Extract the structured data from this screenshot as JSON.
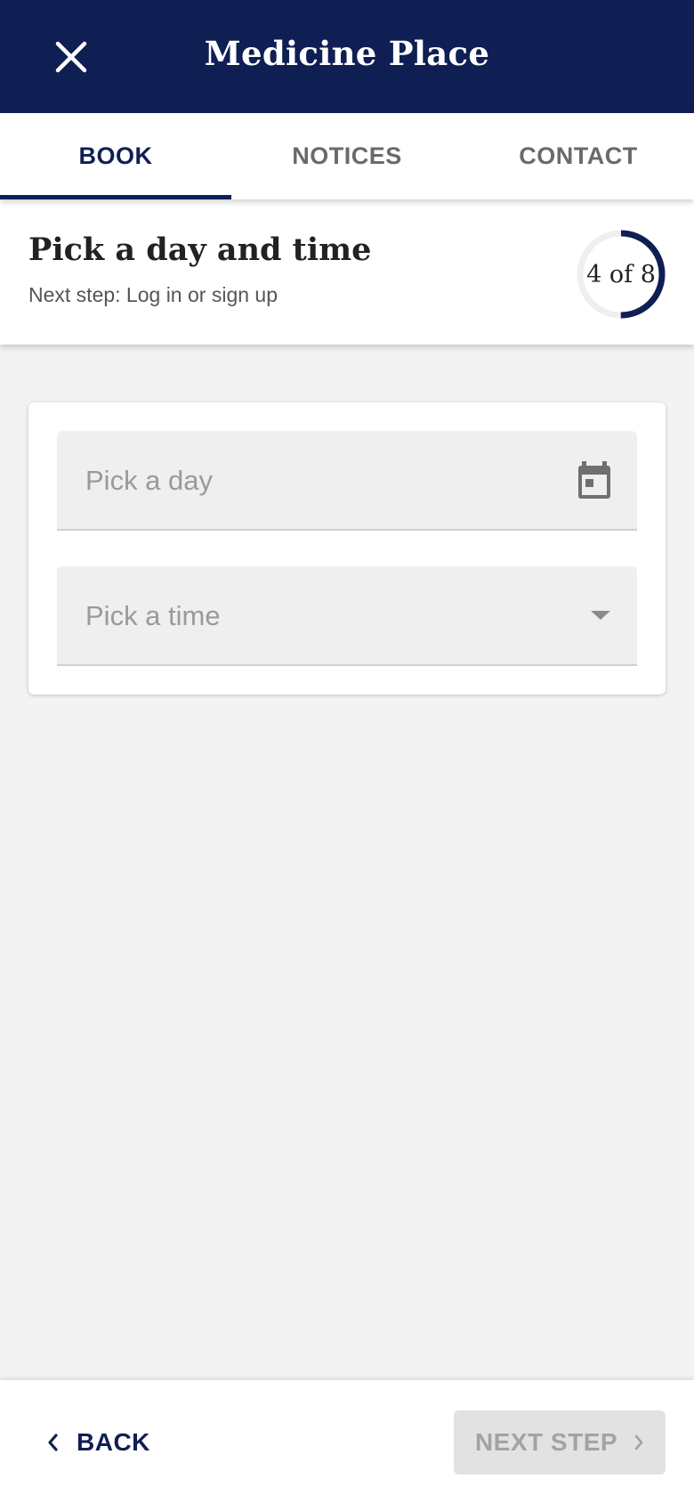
{
  "header": {
    "title": "Medicine Place",
    "close_icon": "close-icon"
  },
  "tabs": [
    {
      "label": "BOOK",
      "active": true
    },
    {
      "label": "NOTICES",
      "active": false
    },
    {
      "label": "CONTACT",
      "active": false
    }
  ],
  "step": {
    "title": "Pick a day and time",
    "next_step": "Next step: Log in or sign up",
    "progress_label": "4 of 8",
    "current": 4,
    "total": 8
  },
  "form": {
    "day": {
      "placeholder": "Pick a day",
      "value": "",
      "icon": "calendar-icon"
    },
    "time": {
      "placeholder": "Pick a time",
      "value": "",
      "icon": "dropdown-arrow-icon"
    }
  },
  "footer": {
    "back_label": "BACK",
    "next_label": "NEXT STEP",
    "next_enabled": false
  },
  "colors": {
    "primary": "#0f1f54",
    "background": "#f3f3f3",
    "disabled": "#e2e2e2"
  }
}
